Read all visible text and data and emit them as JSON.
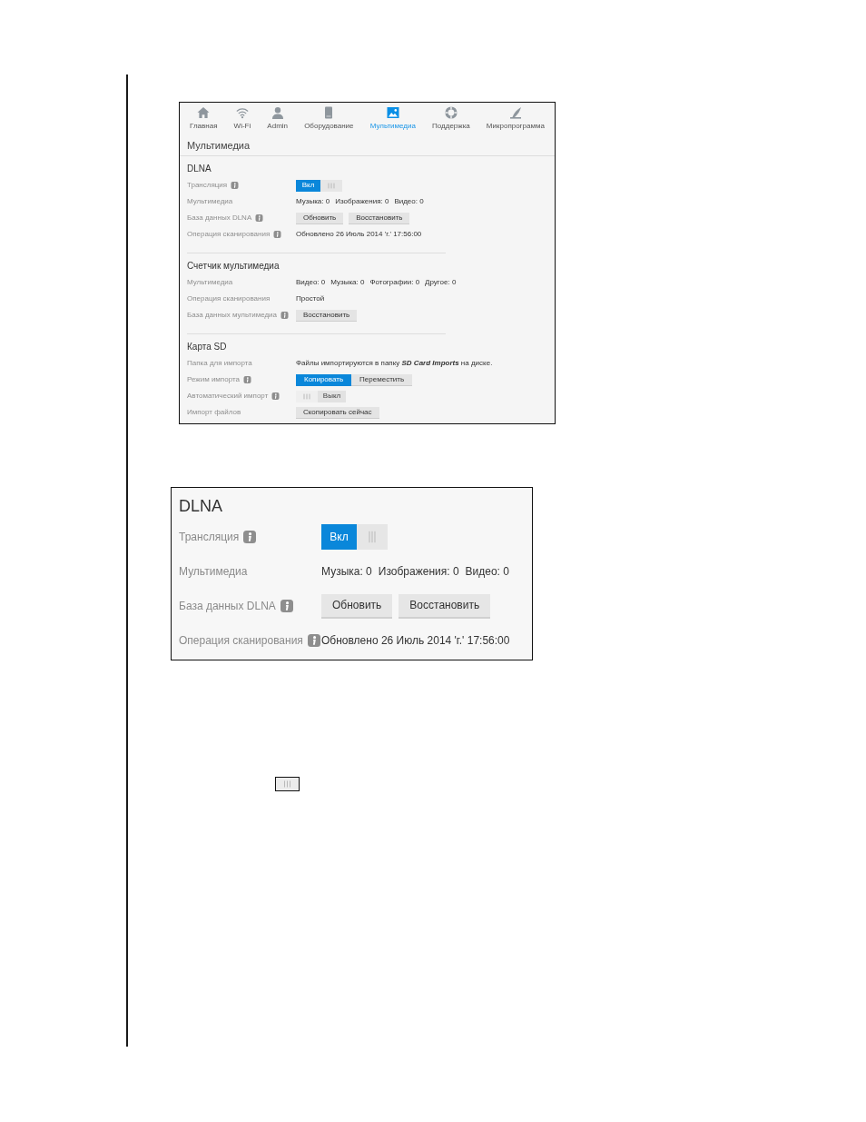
{
  "screenshots": [
    {
      "kind": "full",
      "nav": [
        {
          "label": "Главная",
          "selected": false
        },
        {
          "label": "Wi-Fi",
          "selected": false
        },
        {
          "label": "Admin",
          "selected": false
        },
        {
          "label": "Оборудование",
          "selected": false
        },
        {
          "label": "Мультимедиа",
          "selected": true
        },
        {
          "label": "Поддержка",
          "selected": false
        },
        {
          "label": "Микропрограмма",
          "selected": false
        }
      ],
      "page_title": "Мультимедиа",
      "sections": [
        {
          "title": "DLNA",
          "rows": [
            {
              "label": "Трансляция",
              "info": true,
              "kind": "toggle",
              "on": true,
              "state_label": "Вкл"
            },
            {
              "label": "Мультимедиа",
              "info": false,
              "kind": "stats",
              "items": [
                "Музыка: 0",
                "Изображения: 0",
                "Видео: 0"
              ]
            },
            {
              "label": "База данных DLNA",
              "info": true,
              "kind": "buttons",
              "buttons": [
                "Обновить",
                "Восстановить"
              ]
            },
            {
              "label": "Операция сканирования",
              "info": true,
              "kind": "text",
              "value": "Обновлено 26 Июль 2014 'г.' 17:56:00"
            }
          ]
        },
        {
          "title": "Счетчик мультимедиа",
          "rows": [
            {
              "label": "Мультимедиа",
              "info": false,
              "kind": "stats",
              "items": [
                "Видео: 0",
                "Музыка: 0",
                "Фотографии: 0",
                "Другое: 0"
              ]
            },
            {
              "label": "Операция сканирования",
              "info": false,
              "kind": "text",
              "value": "Простой"
            },
            {
              "label": "База данных мультимедиа",
              "info": true,
              "kind": "buttons",
              "buttons": [
                "Восстановить"
              ]
            }
          ]
        },
        {
          "title": "Карта SD",
          "rows": [
            {
              "label": "Папка для импорта",
              "info": false,
              "kind": "text",
              "value": "Файлы импортируются в папку **SD Card Imports** на диске."
            },
            {
              "label": "Режим импорта",
              "info": true,
              "kind": "segmented",
              "options": [
                {
                  "label": "Копировать",
                  "selected": true
                },
                {
                  "label": "Переместить",
                  "selected": false
                }
              ]
            },
            {
              "label": "Автоматический импорт",
              "info": true,
              "kind": "toggle",
              "on": false,
              "state_label": "Выкл"
            },
            {
              "label": "Импорт файлов",
              "info": false,
              "kind": "buttons",
              "buttons": [
                "Скопировать сейчас"
              ]
            }
          ]
        }
      ]
    },
    {
      "kind": "detail",
      "sections": [
        {
          "title": "DLNA",
          "rows": [
            {
              "label": "Трансляция",
              "info": true,
              "kind": "toggle",
              "on": true,
              "state_label": "Вкл"
            },
            {
              "label": "Мультимедиа",
              "info": false,
              "kind": "stats",
              "items": [
                "Музыка: 0",
                "Изображения: 0",
                "Видео: 0"
              ]
            },
            {
              "label": "База данных DLNA",
              "info": true,
              "kind": "buttons",
              "buttons": [
                "Обновить",
                "Восстановить"
              ]
            },
            {
              "label": "Операция сканирования",
              "info": true,
              "kind": "text",
              "value": "Обновлено 26 Июль 2014 'г.' 17:56:00"
            }
          ]
        }
      ]
    }
  ]
}
